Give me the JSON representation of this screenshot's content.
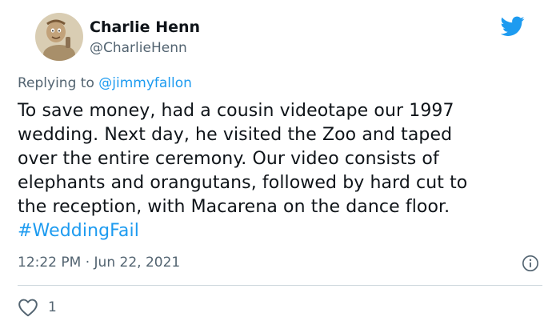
{
  "author": {
    "display_name": "Charlie Henn",
    "handle": "@CharlieHenn"
  },
  "reply": {
    "prefix": "Replying to ",
    "mention": "@jimmyfallon"
  },
  "body_lines": [
    "To save money, had a cousin videotape our 1997",
    "wedding. Next day, he visited the Zoo and taped",
    "over the entire ceremony. Our video consists of",
    "elephants and orangutans, followed by hard cut to",
    "the reception, with Macarena on the dance floor."
  ],
  "hashtag": "#WeddingFail",
  "meta": {
    "time": "12:22 PM",
    "separator": "·",
    "date": "Jun 22, 2021"
  },
  "actions": {
    "like_count": "1"
  },
  "icons": {
    "brand": "twitter-bird-icon",
    "info": "info-icon",
    "like": "heart-icon"
  },
  "colors": {
    "brand_blue": "#1d9bf0",
    "text": "#0f1419",
    "muted": "#536471",
    "divider": "#cfd9de"
  }
}
